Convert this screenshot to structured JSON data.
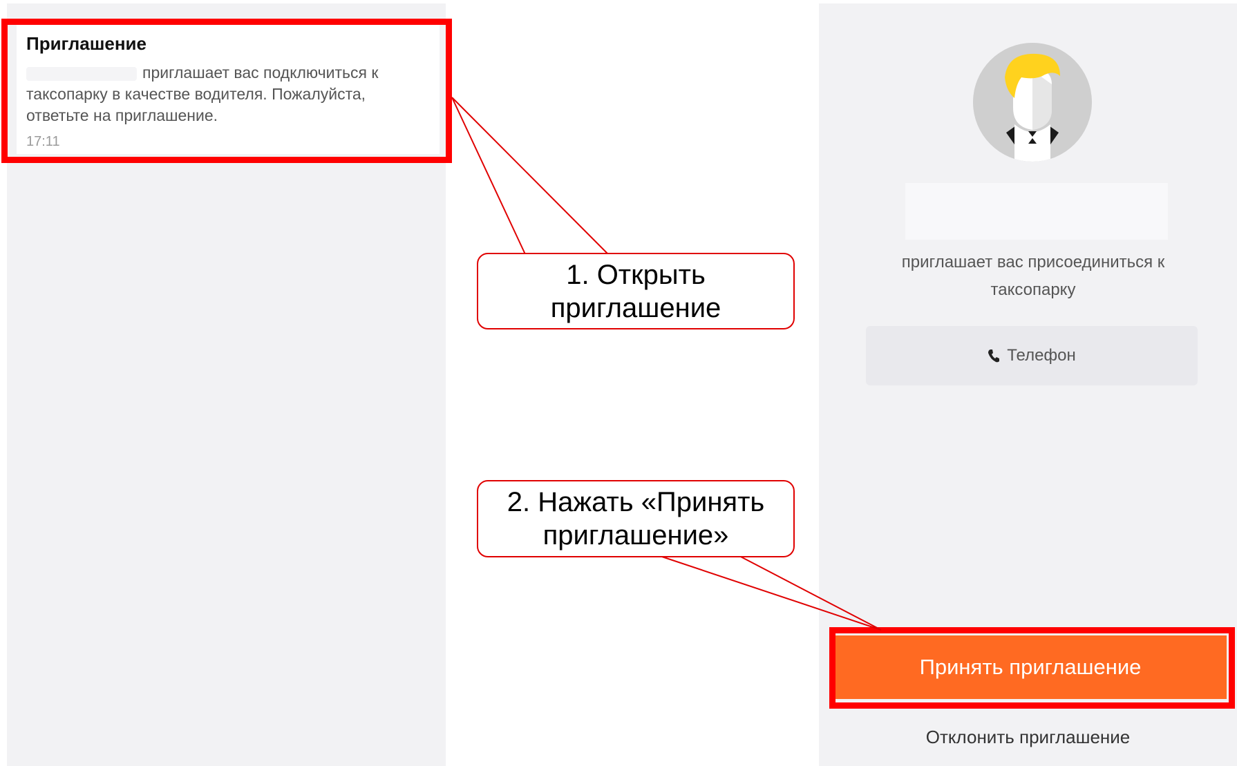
{
  "notification": {
    "title": "Приглашение",
    "body": "приглашает вас подключиться к таксопарку в качестве водителя. Пожалуйста, ответьте на приглашение.",
    "time": "17:11"
  },
  "invite_screen": {
    "invite_text": "приглашает вас присоединиться к таксопарку",
    "phone_label": "Телефон",
    "accept_label": "Принять приглашение",
    "decline_label": "Отклонить приглашение"
  },
  "annotations": {
    "step1": "1. Открыть приглашение",
    "step2": "2. Нажать «Принять приглашение»"
  },
  "colors": {
    "highlight": "#ff0000",
    "accept_button": "#ff6a22",
    "panel_bg": "#f2f2f4"
  },
  "icons": [
    "avatar-icon",
    "phone-icon"
  ]
}
